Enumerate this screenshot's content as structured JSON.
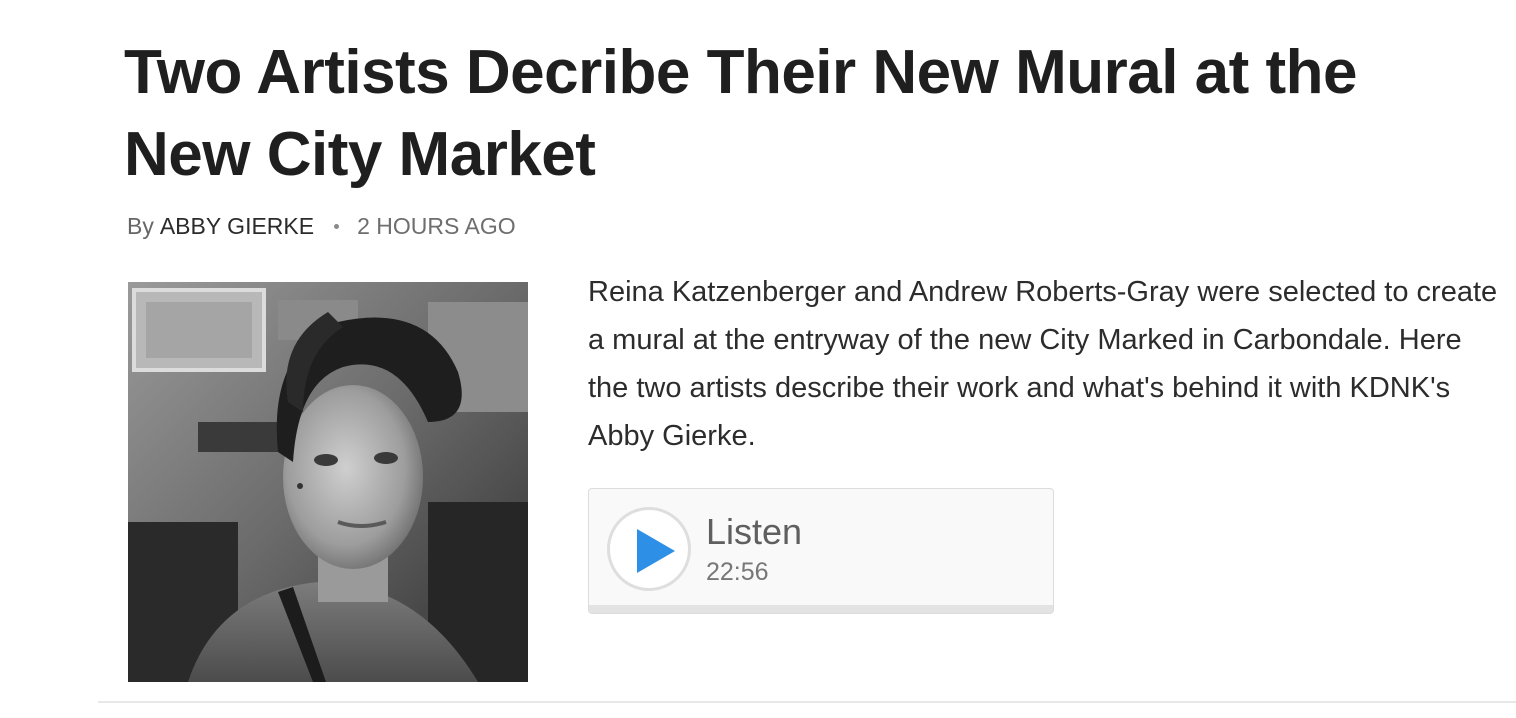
{
  "article": {
    "title": "Two Artists Decribe Their New Mural at the New City Market",
    "byline_prefix": "By",
    "author": "ABBY GIERKE",
    "timestamp": "2 HOURS AGO",
    "teaser": "Reina Katzenberger and Andrew Roberts-Gray were selected to create a mural at the entryway of the new City Marked in Carbondale. Here the two artists describe their work and what's behind it with KDNK's Abby Gierke."
  },
  "player": {
    "label": "Listen",
    "duration": "22:56",
    "icon": "play-icon",
    "accent_color": "#2e8fe6"
  }
}
